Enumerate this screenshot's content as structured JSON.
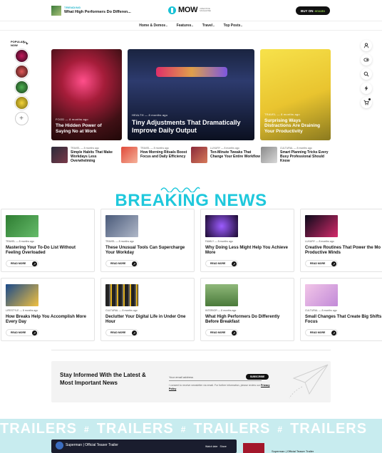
{
  "topbar": {
    "trend_tag": "TRENDING",
    "trend_title": "What High Performers Do Differen...",
    "logo": "MOW",
    "logo_sub": "CREATIVE MAGAZINE",
    "buy_prefix": "BUY ON",
    "buy_brand": "envato"
  },
  "nav": [
    {
      "label": "Home & Demos"
    },
    {
      "label": "Features"
    },
    {
      "label": "Travel"
    },
    {
      "label": "Top Posts"
    }
  ],
  "popular": {
    "label": "POPULAR NOW",
    "plus": "+"
  },
  "heroes": [
    {
      "meta": "FOOD  —  8 months ago",
      "title": "The Hidden Power of Saying No at Work"
    },
    {
      "meta": "HEALTH  —  8 months ago",
      "title": "Tiny Adjustments That Dramatically Improve Daily Output"
    },
    {
      "meta": "TRAVEL  —  8 months ago",
      "title": "Surprising Ways Distractions Are Draining Your Productivity"
    }
  ],
  "subs": [
    {
      "meta": "TRAVEL  —  8 months ago",
      "title": "Simple Habits That Make Workdays Less Overwhelming"
    },
    {
      "meta": "TRAVEL  —  8 months ago",
      "title": "How Morning Rituals Boost Focus and Daily Efficiency"
    },
    {
      "meta": "LUXURY  —  8 months ago",
      "title": "Ten-Minute Tweaks That Change Your Entire Workflow"
    },
    {
      "meta": "CULTURAL  —  8 months ago",
      "title": "Smart Planning Tricks Every Busy Professional Should Know"
    }
  ],
  "breaking": "BREAKING NEWS",
  "cards_row1": [
    {
      "meta": "TRAVEL  —  8 months ago",
      "title": "Mastering Your To-Do List Without Feeling Overloaded",
      "more": "READ MORE"
    },
    {
      "meta": "TRAVEL  —  8 months ago",
      "title": "These Unusual Tools Can Supercharge Your Workday",
      "more": "READ MORE"
    },
    {
      "meta": "FAMILY  —  8 months ago",
      "title": "Why Doing Less Might Help You Achieve More",
      "more": "READ MORE"
    },
    {
      "meta": "LUXURY  —  8 months ago",
      "title": "Creative Routines That Power the Mo Productive Minds",
      "more": "READ MORE"
    }
  ],
  "cards_row2": [
    {
      "meta": "LIFESTYLE  —  8 months ago",
      "title": "How Breaks Help You Accomplish More Every Day",
      "more": "READ MORE"
    },
    {
      "meta": "CULTURAL  —  8 months ago",
      "title": "Declutter Your Digital Life in Under One Hour",
      "more": "READ MORE"
    },
    {
      "meta": "INTERIOR  —  8 months ago",
      "title": "What High Performers Do Differently Before Breakfast",
      "more": "READ MORE"
    },
    {
      "meta": "CULTURAL  —  8 months ago",
      "title": "Small Changes That Create Big Shifts in Focus",
      "more": "READ MORE"
    }
  ],
  "newsletter": {
    "heading": "Stay Informed With the Latest & Most Important News",
    "placeholder": "Your email address",
    "button": "SUBSCRIBE",
    "consent": "I consent to receive newsletter via email. For further information, please review our",
    "policy": "Privacy Policy"
  },
  "trailers": {
    "word": "TRAILERS",
    "hash": "#",
    "video_title": "Superman | Official Teaser Trailer",
    "watch_later": "Watch later",
    "share": "Share",
    "side_title": "Superman | Official Teaser Trailer"
  }
}
